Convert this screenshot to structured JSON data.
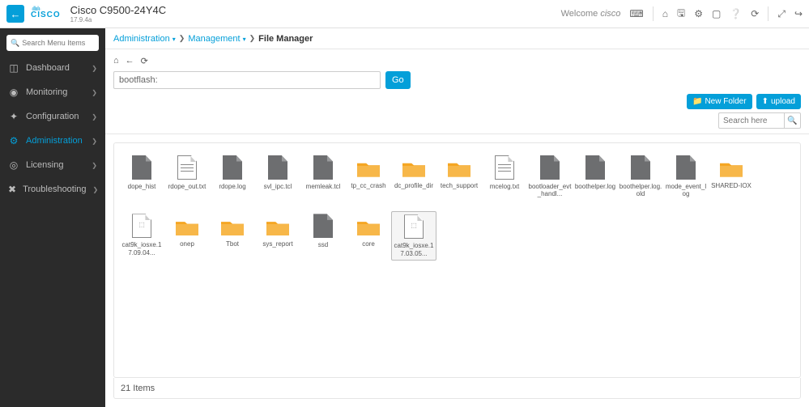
{
  "header": {
    "device_name": "Cisco C9500-24Y4C",
    "version": "17.9.4a",
    "welcome": "Welcome",
    "user": "cisco"
  },
  "sidebar": {
    "search_placeholder": "Search Menu Items",
    "items": [
      {
        "label": "Dashboard",
        "icon": "◫",
        "active": false
      },
      {
        "label": "Monitoring",
        "icon": "◉",
        "active": false
      },
      {
        "label": "Configuration",
        "icon": "✦",
        "active": false
      },
      {
        "label": "Administration",
        "icon": "⚙",
        "active": true
      },
      {
        "label": "Licensing",
        "icon": "◎",
        "active": false
      },
      {
        "label": "Troubleshooting",
        "icon": "✖",
        "active": false
      }
    ]
  },
  "breadcrumb": {
    "a": "Administration",
    "b": "Management",
    "c": "File Manager"
  },
  "toolbar": {
    "path_value": "bootflash:",
    "go": "Go",
    "new_folder": "New Folder",
    "upload": "upload",
    "search_placeholder": "Search here"
  },
  "files": [
    {
      "name": "dope_hist",
      "type": "file"
    },
    {
      "name": "rdope_out.txt",
      "type": "txt"
    },
    {
      "name": "rdope.log",
      "type": "file"
    },
    {
      "name": "svl_ipc.tcl",
      "type": "file"
    },
    {
      "name": "memleak.tcl",
      "type": "file"
    },
    {
      "name": "tp_cc_crash",
      "type": "folder"
    },
    {
      "name": "dc_profile_dir",
      "type": "folder"
    },
    {
      "name": "tech_support",
      "type": "folder"
    },
    {
      "name": "mcelog.txt",
      "type": "txt"
    },
    {
      "name": "bootloader_evt_handl...",
      "type": "file"
    },
    {
      "name": "boothelper.log",
      "type": "file"
    },
    {
      "name": "boothelper.log.old",
      "type": "file"
    },
    {
      "name": "mode_event_log",
      "type": "file"
    },
    {
      "name": "SHARED-IOX",
      "type": "folder"
    },
    {
      "name": "cat9k_iosxe.17.09.04...",
      "type": "zip"
    },
    {
      "name": "onep",
      "type": "folder"
    },
    {
      "name": "Tbot",
      "type": "folder"
    },
    {
      "name": "sys_report",
      "type": "folder"
    },
    {
      "name": "ssd",
      "type": "file"
    },
    {
      "name": "core",
      "type": "folder"
    },
    {
      "name": "cat9k_iosxe.17.03.05...",
      "type": "zip",
      "selected": true
    }
  ],
  "footer": {
    "count": "21 Items"
  }
}
